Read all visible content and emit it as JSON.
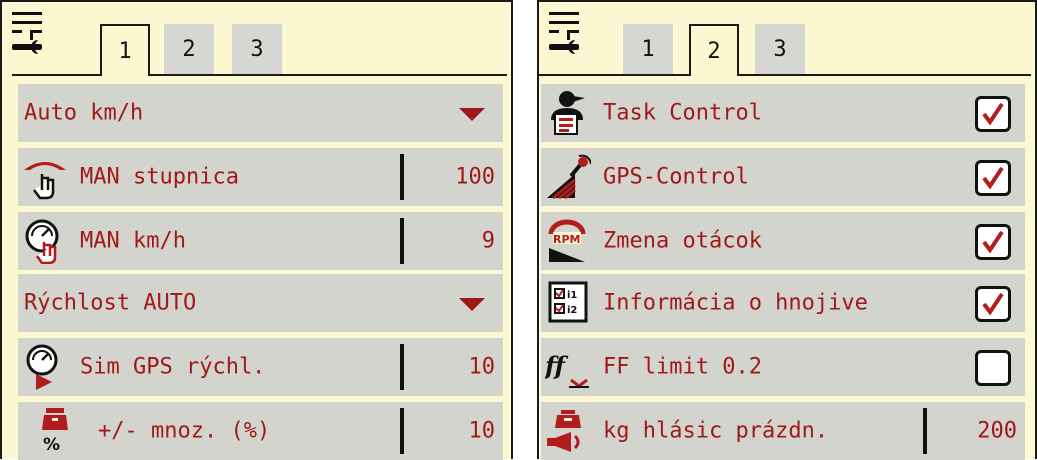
{
  "left_panel": {
    "tabs": [
      {
        "label": "1",
        "active": true
      },
      {
        "label": "2",
        "active": false
      },
      {
        "label": "3",
        "active": false
      }
    ],
    "rows": {
      "auto_kmh": {
        "label": "Auto km/h",
        "icon": "chevron-down-icon"
      },
      "man_scale": {
        "label": "MAN stupnica",
        "value": "100",
        "icon": "scale-hand-icon"
      },
      "man_kmh": {
        "label": "MAN km/h",
        "value": "9",
        "icon": "speedometer-hand-icon"
      },
      "speed_auto": {
        "label": "Rýchlost AUTO",
        "icon": "chevron-down-icon"
      },
      "sim_gps": {
        "label": "Sim GPS rýchl.",
        "value": "10",
        "icon": "speedometer-play-icon"
      },
      "quantity": {
        "label": "+/- mnoz. (%)",
        "value": "10",
        "icon": "weight-percent-icon"
      }
    }
  },
  "right_panel": {
    "tabs": [
      {
        "label": "1",
        "active": false
      },
      {
        "label": "2",
        "active": true
      },
      {
        "label": "3",
        "active": false
      }
    ],
    "rows": {
      "task_control": {
        "label": "Task Control",
        "checked": true,
        "icon": "operator-terminal-icon"
      },
      "gps_control": {
        "label": "GPS-Control",
        "checked": true,
        "icon": "gps-spreader-icon"
      },
      "rpm_change": {
        "label": "Zmena otácok",
        "checked": true,
        "icon": "rpm-gauge-icon"
      },
      "fertilizer_info": {
        "label": "Informácia o hnojive",
        "checked": true,
        "icon": "fertilizer-info-icon"
      },
      "ff_limit": {
        "label": "FF limit 0.2",
        "checked": false,
        "icon": "ff-limit-icon"
      },
      "kg_alarm": {
        "label": "kg hlásic prázdn.",
        "value": "200",
        "icon": "weight-horn-icon"
      }
    }
  },
  "colors": {
    "panel_bg": "#fbf8d2",
    "row_bg": "#d4d4cf",
    "text": "#a01919",
    "checkmark": "#b11d1d"
  }
}
